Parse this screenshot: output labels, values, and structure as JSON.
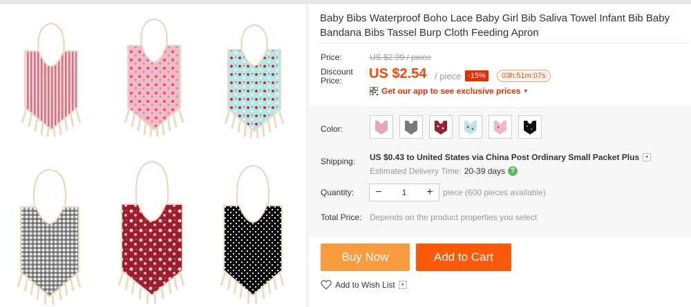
{
  "product": {
    "title": "Baby Bibs Waterproof Boho Lace Baby Girl Bib Saliva Towel Infant Bib Baby Bandana Bibs Tassel Burp Cloth Feeding Apron"
  },
  "gallery": {
    "images": [
      {
        "name": "pink-stripe-bib",
        "fabric": "#e7aab3"
      },
      {
        "name": "pink-floral-bib",
        "fabric": "#f2a6bf"
      },
      {
        "name": "aqua-floral-bib",
        "fabric": "#a9dfe0"
      },
      {
        "name": "gingham-bib",
        "fabric": "#777777"
      },
      {
        "name": "red-floral-bib",
        "fabric": "#9e1c2b"
      },
      {
        "name": "black-polka-bib",
        "fabric": "#111111"
      }
    ]
  },
  "price": {
    "label": "Price:",
    "original": "US $2.99 / piece",
    "discount_label_1": "Discount",
    "discount_label_2": "Price:",
    "current": "US $2.54",
    "unit": "/ piece",
    "discount_pct": "-15%",
    "timer": "03h:51m:07s",
    "app_text": "Get our app to see exclusive prices",
    "app_caret": "▾"
  },
  "color": {
    "label": "Color:",
    "swatches": [
      "pink-stripe-bib",
      "gray-bib",
      "red-floral-bib",
      "aqua-floral-bib",
      "pink-floral-bib",
      "black-polka-bib"
    ]
  },
  "shipping": {
    "label": "Shipping:",
    "text": "US $0.43 to United States via China Post Ordinary Small Packet Plus",
    "eta_label": "Estimated Delivery Time:",
    "eta_days": "20-39 days",
    "help": "?"
  },
  "quantity": {
    "label": "Quantity:",
    "minus": "−",
    "value": "1",
    "plus": "+",
    "available": "piece (600 pieces available)"
  },
  "total": {
    "label": "Total Price:",
    "value": "Depends on the product properties you select"
  },
  "actions": {
    "buy_now": "Buy Now",
    "add_to_cart": "Add to Cart",
    "wishlist": "Add to Wish List"
  },
  "colors": {
    "accent": "#ff4400",
    "buy_now_bg": "#f89d3f",
    "cart_bg": "#fa5a0a"
  }
}
